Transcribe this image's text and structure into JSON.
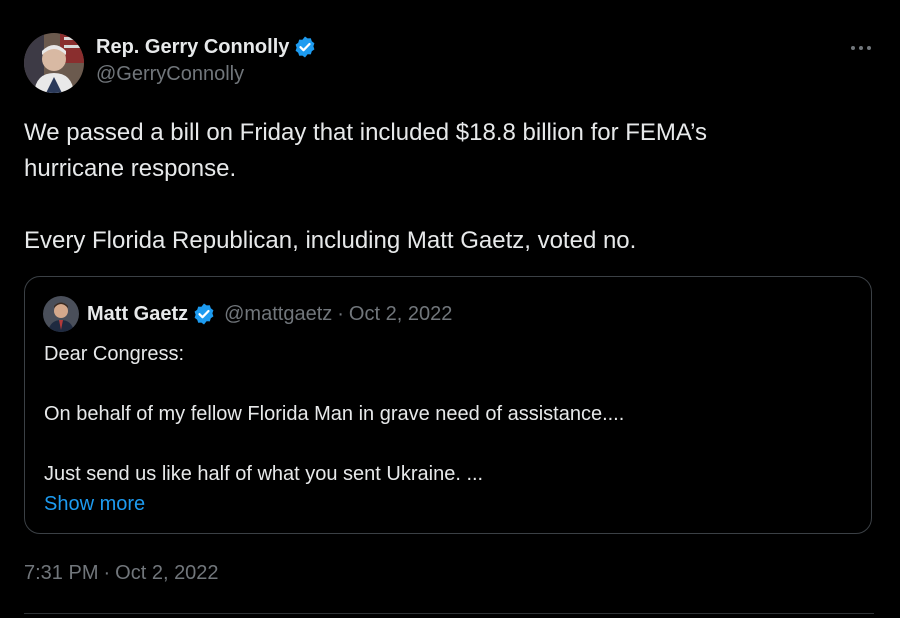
{
  "tweet": {
    "author_name": "Rep. Gerry Connolly",
    "author_handle": "@GerryConnolly",
    "text_line1": "We passed a bill on Friday that included $18.8 billion for FEMA’s",
    "text_line2": "hurricane response.",
    "text_line3": "Every Florida Republican, including Matt Gaetz, voted no.",
    "time": "7:31 PM",
    "date": "Oct 2, 2022",
    "separator": "·"
  },
  "quote": {
    "author_name": "Matt Gaetz",
    "author_handle": "@mattgaetz",
    "separator": "·",
    "date": "Oct 2, 2022",
    "line1": "Dear Congress:",
    "line2": "On behalf of my fellow Florida Man in grave need of assistance....",
    "line3": "Just send us like half of what you sent Ukraine. ...",
    "show_more": "Show more"
  },
  "icons": {
    "verified": "verified-badge-icon",
    "more": "more-dots-icon"
  },
  "colors": {
    "background": "#000000",
    "text": "#e7e9ea",
    "secondary": "#71767b",
    "accent": "#1d9bf0",
    "border": "#3b4045"
  }
}
